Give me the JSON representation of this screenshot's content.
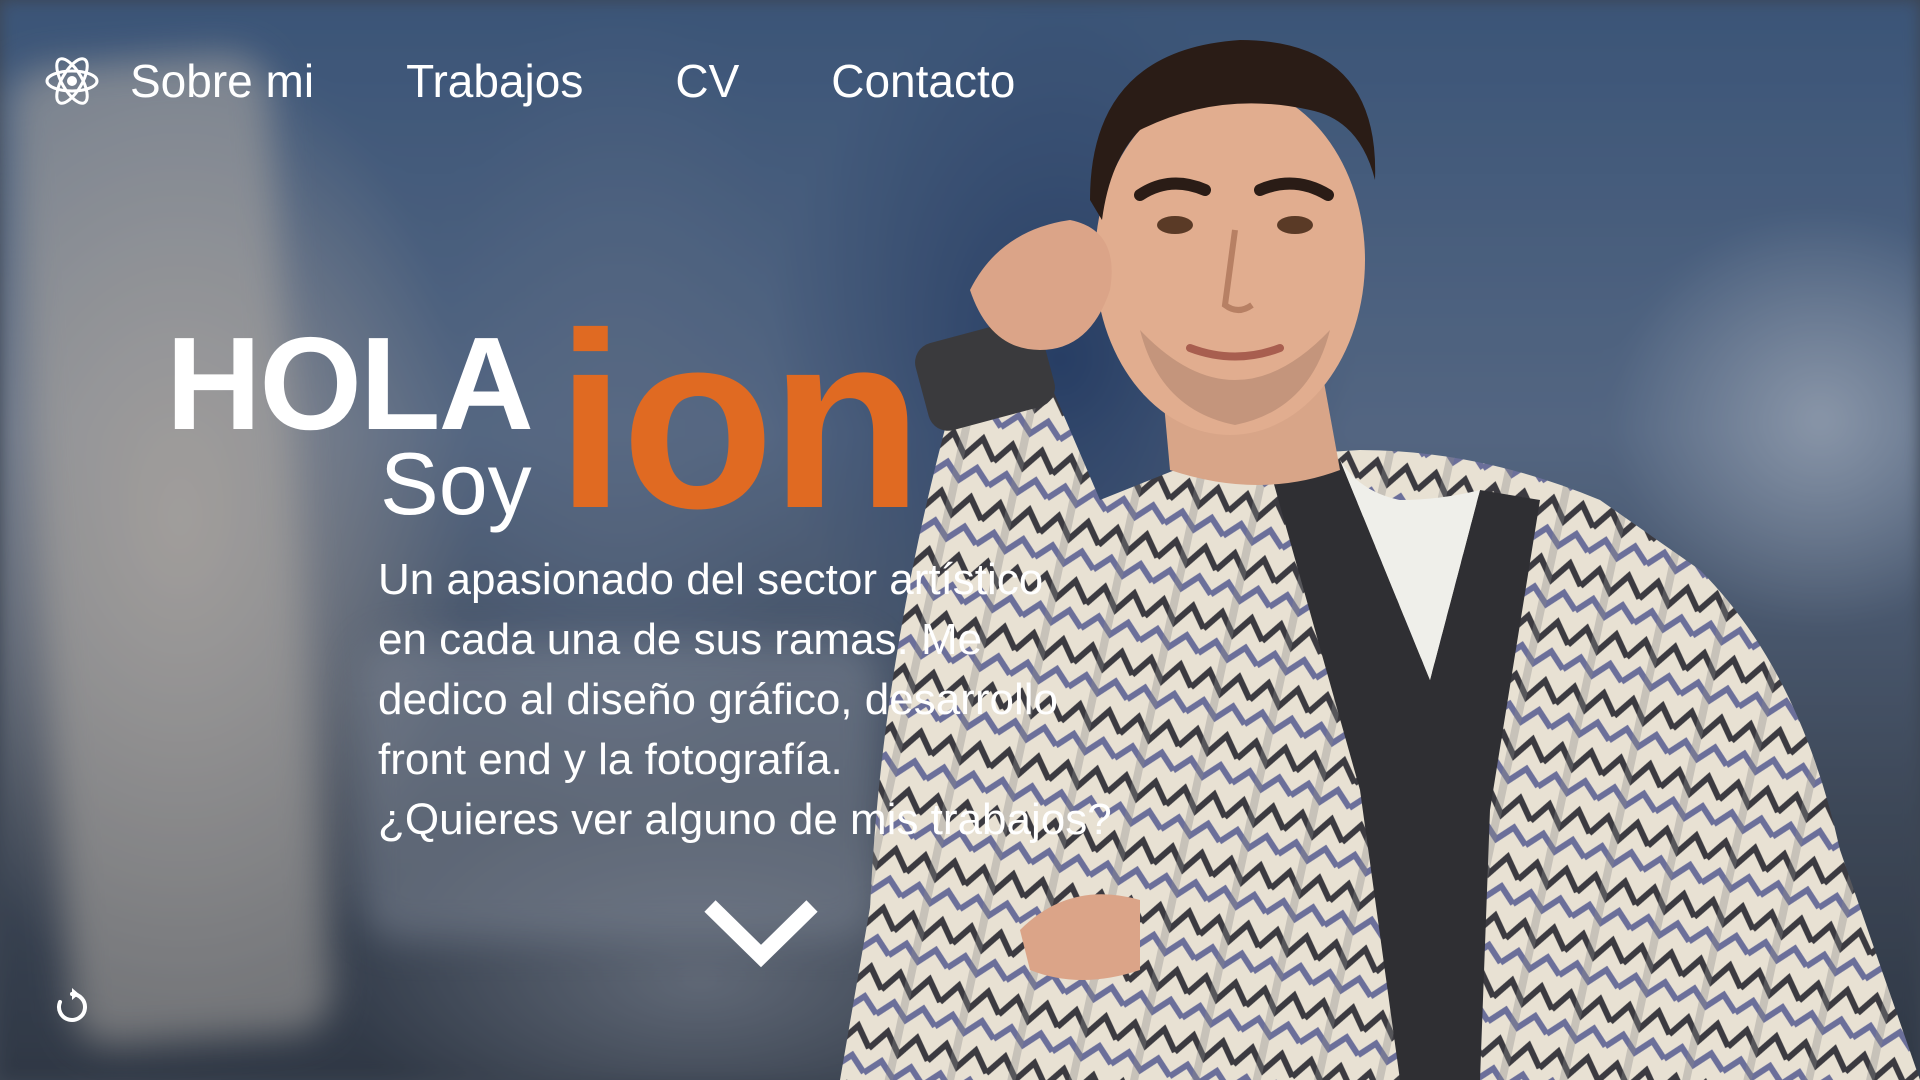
{
  "nav": {
    "logo_icon": "atom-icon",
    "items": [
      {
        "label": "Sobre mi"
      },
      {
        "label": "Trabajos"
      },
      {
        "label": "CV"
      },
      {
        "label": "Contacto"
      }
    ]
  },
  "hero": {
    "greeting": "HOLA",
    "intro": "Soy",
    "name": "ion",
    "bio_lines": [
      "Un apasionado del sector artístico",
      "en cada una de sus ramas. Me",
      "dedico al diseño gráfico, desarrollo",
      "front end y la fotografía.",
      "¿Quieres ver alguno de mis trabajos?"
    ]
  },
  "controls": {
    "scroll_icon": "chevron-down-icon",
    "reload_icon": "reload-icon"
  },
  "colors": {
    "accent": "#e06a22",
    "text": "#ffffff"
  }
}
